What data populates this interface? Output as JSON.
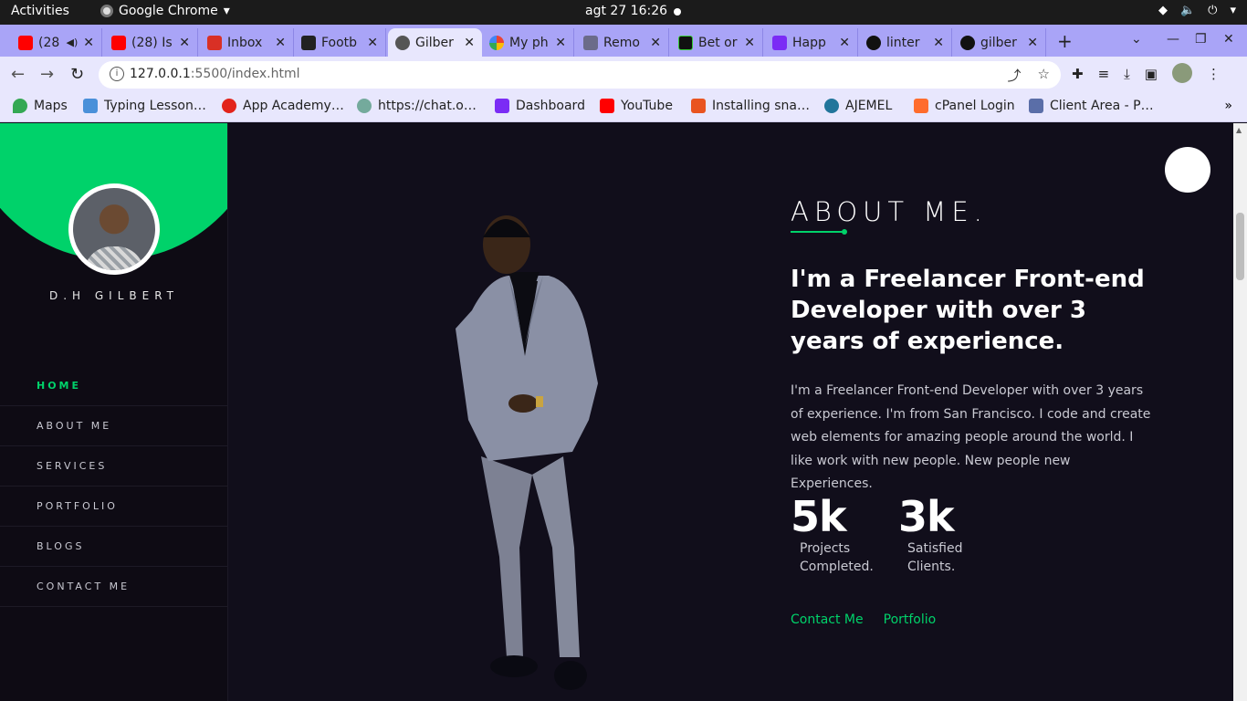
{
  "system_bar": {
    "activities": "Activities",
    "app_name": "Google Chrome",
    "clock": "agt 27  16:26"
  },
  "tabs": [
    {
      "title": "(28",
      "favicon": "youtube-icon",
      "color": "#ff0000"
    },
    {
      "title": "(28) Is",
      "favicon": "youtube-icon",
      "color": "#ff0000"
    },
    {
      "title": "Inbox",
      "favicon": "gmail-icon",
      "color": "#d93025"
    },
    {
      "title": "Footb",
      "favicon": "sport-icon",
      "color": "#222222"
    },
    {
      "title": "Gilber",
      "favicon": "globe-icon",
      "color": "#555555",
      "active": true
    },
    {
      "title": "My ph",
      "favicon": "photos-icon",
      "color": "#fbbc04"
    },
    {
      "title": "Remo",
      "favicon": "layers-icon",
      "color": "#6b6b8a"
    },
    {
      "title": "Bet or",
      "favicon": "bet-icon",
      "color": "#111111"
    },
    {
      "title": "Happ",
      "favicon": "happ-icon",
      "color": "#7b2cf5"
    },
    {
      "title": "linter",
      "favicon": "github-icon",
      "color": "#111111"
    },
    {
      "title": "gilber",
      "favicon": "github-icon",
      "color": "#111111"
    }
  ],
  "toolbar": {
    "url_host": "127.0.0.1",
    "url_path": ":5500/index.html"
  },
  "bookmarks": [
    {
      "label": "Maps",
      "icon": "maps-icon",
      "color": "#34a853"
    },
    {
      "label": "Typing Lesson…",
      "icon": "typing-icon",
      "color": "#4a90d9"
    },
    {
      "label": "App Academy…",
      "icon": "app-academy-icon",
      "color": "#e2231a"
    },
    {
      "label": "https://chat.o…",
      "icon": "chatgpt-icon",
      "color": "#74aa9c"
    },
    {
      "label": "Dashboard",
      "icon": "dashboard-icon",
      "color": "#7b2cf5"
    },
    {
      "label": "YouTube",
      "icon": "youtube-icon",
      "color": "#ff0000"
    },
    {
      "label": "Installing sna…",
      "icon": "snap-icon",
      "color": "#e95420"
    },
    {
      "label": "AJEMEL",
      "icon": "wordpress-icon",
      "color": "#21759b"
    },
    {
      "label": "cPanel Login",
      "icon": "cpanel-icon",
      "color": "#ff6c2c"
    },
    {
      "label": "Client Area - P…",
      "icon": "client-area-icon",
      "color": "#5a6ea8"
    }
  ],
  "sidebar": {
    "name": "D.H GILBERT",
    "accent": "#00d26a",
    "menu": [
      {
        "label": "HOME",
        "active": true
      },
      {
        "label": "ABOUT ME"
      },
      {
        "label": "SERVICES"
      },
      {
        "label": "PORTFOLIO"
      },
      {
        "label": "BLOGS"
      },
      {
        "label": "CONTACT ME"
      }
    ]
  },
  "about": {
    "heading": "ABOUT ME.",
    "headline": "I'm a Freelancer Front-end Developer with over 3 years of experience.",
    "description": "I'm a Freelancer Front-end Developer with over 3 years of experience. I'm from San Francisco. I code and create web elements for amazing people around the world. I like work with new people. New people new Experiences.",
    "stats": [
      {
        "number": "5k",
        "label_line1": "Projects",
        "label_line2": "Completed."
      },
      {
        "number": "3k",
        "label_line1": "Satisfied",
        "label_line2": "Clients."
      }
    ],
    "links": {
      "contact": "Contact Me",
      "portfolio": "Portfolio"
    }
  }
}
